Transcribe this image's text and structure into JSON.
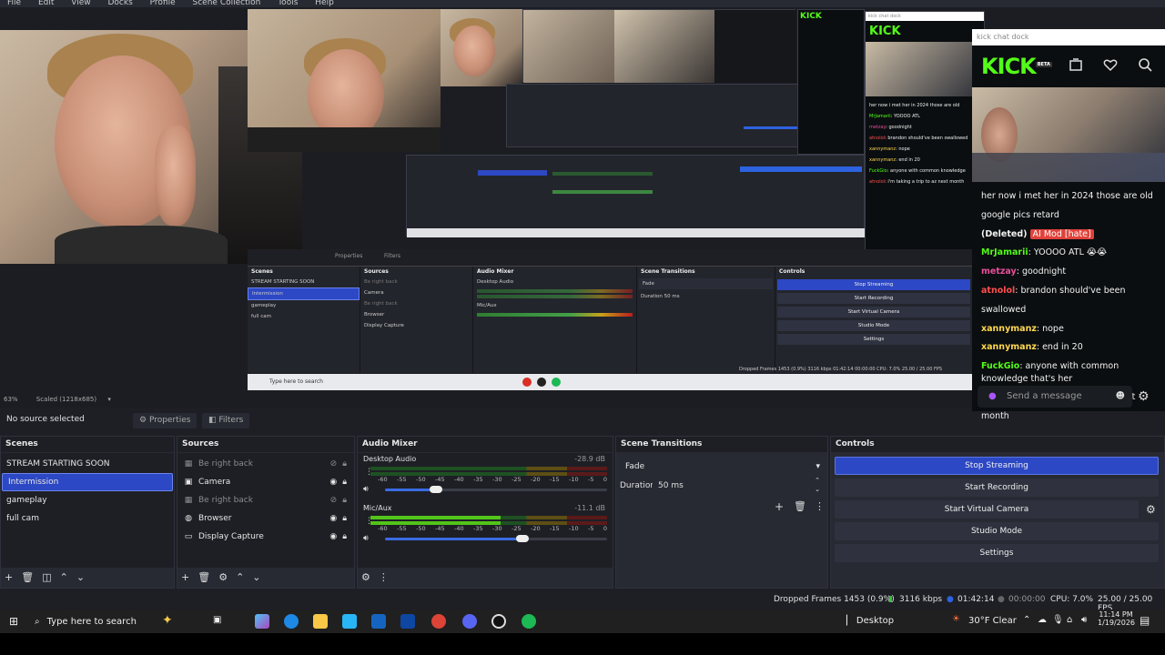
{
  "menu": [
    "File",
    "Edit",
    "View",
    "Docks",
    "Profile",
    "Scene Collection",
    "Tools",
    "Help"
  ],
  "preview": {
    "zoom": "63%",
    "scaled": "Scaled (1218x685)",
    "nested": {
      "scenes_title": "Scenes",
      "sources_title": "Sources",
      "audio_title": "Audio Mixer",
      "transitions_title": "Scene Transitions",
      "controls_title": "Controls",
      "scenes": [
        "STREAM STARTING SOON",
        "Intermission",
        "gameplay",
        "full cam"
      ],
      "sources": [
        "Be right back",
        "Camera",
        "Be right back",
        "Browser",
        "Display Capture"
      ],
      "buttons": [
        "Stop Streaming",
        "Start Recording",
        "Start Virtual Camera",
        "Studio Mode",
        "Settings"
      ],
      "audio": [
        "Desktop Audio",
        "Mic/Aux"
      ],
      "fade": "Fade",
      "duration": "Duration",
      "duration_val": "50 ms",
      "status": "Dropped Frames 1453 (0.9%)   3116 kbps   01:42:14   00:00:00   CPU: 7.0%   25.00 / 25.00 FPS",
      "taskbar_search": "Type here to search",
      "props": "Properties",
      "filters": "Filters"
    }
  },
  "kick": {
    "dock_name": "kick chat dock",
    "logo": "KICK",
    "beta": "BETA",
    "messages": [
      {
        "user": "",
        "text": "her now i met her in 2024 those are old google pics retard",
        "color": "#ffffff"
      },
      {
        "user": "(Deleted)",
        "text": "AI Mod [hate]",
        "color": "#ffffff"
      },
      {
        "user": "MrJamarii",
        "text": ": YOOOO ATL 😭😭",
        "color": "#53fc18"
      },
      {
        "user": "metzay",
        "text": ": goodnight",
        "color": "#e84f9a"
      },
      {
        "user": "atnolol",
        "text": ": brandon should've been swallowed",
        "color": "#ff4f4f"
      },
      {
        "user": "xannymanz",
        "text": ": nope",
        "color": "#ffd84f"
      },
      {
        "user": "xannymanz",
        "text": ": end in 20",
        "color": "#ffd84f"
      },
      {
        "user": "FuckGio",
        "text": ": anyone with common knowledge that's her",
        "color": "#53fc18"
      },
      {
        "user": "atnolol",
        "text": ": i'm taking a trip to az next month",
        "color": "#ff4f4f"
      }
    ],
    "input_placeholder": "Send a message"
  },
  "zoom_bar": {
    "zoom": "63%",
    "scaled": "Scaled (1218x685)"
  },
  "props_bar": {
    "no_source": "No source selected",
    "properties": "Properties",
    "filters": "Filters"
  },
  "scenes": {
    "title": "Scenes",
    "items": [
      "STREAM STARTING SOON",
      "Intermission",
      "gameplay",
      "full cam"
    ],
    "selected_index": 1
  },
  "sources": {
    "title": "Sources",
    "items": [
      {
        "name": "Be right back",
        "visible": false
      },
      {
        "name": "Camera",
        "visible": true
      },
      {
        "name": "Be right back",
        "visible": false
      },
      {
        "name": "Browser",
        "visible": true
      },
      {
        "name": "Display Capture",
        "visible": true
      }
    ]
  },
  "audio": {
    "title": "Audio Mixer",
    "channels": [
      {
        "name": "Desktop Audio",
        "db": "-28.9 dB",
        "level": 0.0,
        "volume": 0.23
      },
      {
        "name": "Mic/Aux",
        "db": "-11.1 dB",
        "level": 0.55,
        "volume": 0.62
      }
    ],
    "scale": [
      "-60",
      "-55",
      "-50",
      "-45",
      "-40",
      "-35",
      "-30",
      "-25",
      "-20",
      "-15",
      "-10",
      "-5",
      "0"
    ]
  },
  "transitions": {
    "title": "Scene Transitions",
    "type": "Fade",
    "duration_label": "Duration",
    "duration_value": "50 ms"
  },
  "controls": {
    "title": "Controls",
    "buttons": [
      "Stop Streaming",
      "Start Recording",
      "Start Virtual Camera",
      "Studio Mode",
      "Settings"
    ]
  },
  "status": {
    "dropped": "Dropped Frames 1453 (0.9%)",
    "kbps": "3116 kbps",
    "stream_time": "01:42:14",
    "rec_time": "00:00:00",
    "cpu": "CPU: 7.0%",
    "fps": "25.00 / 25.00 FPS"
  },
  "taskbar": {
    "search": "Type here to search",
    "desktop": "Desktop",
    "weather": "30°F  Clear",
    "time": "11:14 PM",
    "date": "1/19/2026"
  },
  "colors": {
    "accent": "#2d48c4",
    "kick_green": "#53fc18"
  }
}
